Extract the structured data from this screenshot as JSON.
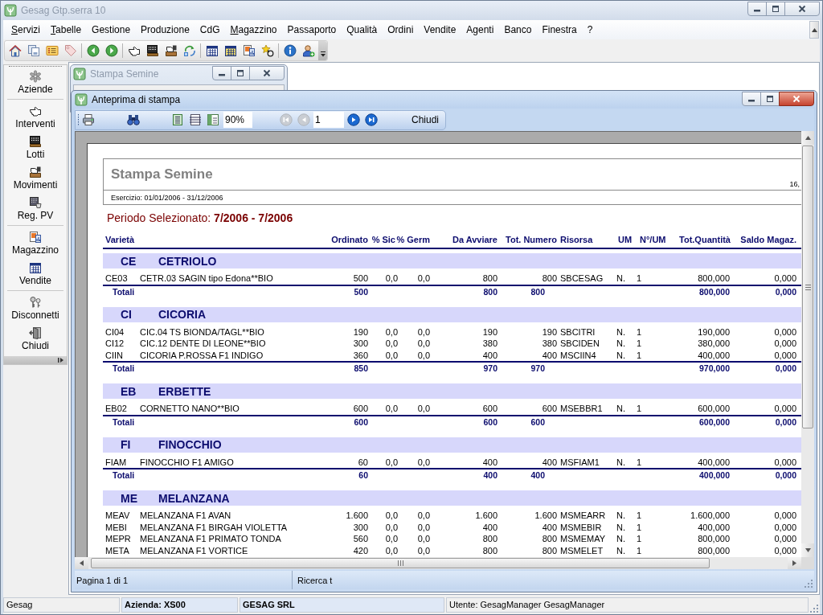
{
  "window": {
    "title": "Gesag Gtp.serra 10",
    "active": false
  },
  "menu": [
    {
      "label": "Servizi",
      "underlined": true
    },
    {
      "label": "Tabelle",
      "underlined": true
    },
    {
      "label": "Gestione",
      "underlined": false
    },
    {
      "label": "Produzione",
      "underlined": false
    },
    {
      "label": "CdG",
      "underlined": false
    },
    {
      "label": "Magazzino",
      "underlined": true
    },
    {
      "label": "Passaporto",
      "underlined": false
    },
    {
      "label": "Qualità",
      "underlined": false
    },
    {
      "label": "Ordini",
      "underlined": false
    },
    {
      "label": "Vendite",
      "underlined": false
    },
    {
      "label": "Agenti",
      "underlined": false
    },
    {
      "label": "Banco",
      "underlined": false
    },
    {
      "label": "Finestra",
      "underlined": false
    },
    {
      "label": "?",
      "underlined": false
    }
  ],
  "sidebar": {
    "groups": [
      [
        {
          "label": "Aziende"
        }
      ],
      [
        {
          "label": "Interventi"
        },
        {
          "label": "Lotti"
        },
        {
          "label": "Movimenti"
        },
        {
          "label": "Reg. PV"
        }
      ],
      [
        {
          "label": "Magazzino"
        },
        {
          "label": "Vendite"
        }
      ],
      [
        {
          "label": "Disconnetti"
        },
        {
          "label": "Chiudi"
        }
      ]
    ]
  },
  "background_window": {
    "title": "Stampa Semine",
    "active": false
  },
  "preview_window": {
    "title": "Anteprima di stampa",
    "active": true,
    "toolbar": {
      "zoom": "90%",
      "page": "1",
      "close_label": "Chiudi",
      "nav": [
        {
          "kind": "first",
          "disabled": true
        },
        {
          "kind": "previous",
          "disabled": true
        },
        {
          "kind": "next",
          "disabled": false
        },
        {
          "kind": "last",
          "disabled": false
        }
      ]
    },
    "report": {
      "title": "Stampa Semine",
      "corner_text": "16,",
      "period": "Esercizio: 01/01/2006 - 31/12/2006",
      "selection": "Periodo Selezionato: **7/2006 - 7/2006**",
      "columns": [
        "Varietà",
        "Ordinato",
        "% Sic",
        "% Germ",
        "Da Avviare",
        "Tot. Numero",
        "Risorsa",
        "UM",
        "N°/UM",
        "Tot.Quantità",
        "Saldo Magaz."
      ],
      "groups": [
        {
          "code": "CE",
          "name": "CETRIOLO",
          "rows": [
            [
              "CE03",
              "CETR.03 SAGIN tipo Edona**BIO",
              "500",
              "0,0",
              "0,0",
              "800",
              "800",
              "SBCESAG",
              "N.",
              "1",
              "800,000",
              "0,000"
            ]
          ],
          "totals": {
            "label": "Totali",
            "ordinato": "500",
            "da_avviare": "800",
            "tot_numero": "800",
            "tot_quantita": "800,000",
            "saldo": "0,000"
          }
        },
        {
          "code": "CI",
          "name": "CICORIA",
          "rows": [
            [
              "CI04",
              "CIC.04 TS BIONDA/TAGL**BIO",
              "190",
              "0,0",
              "0,0",
              "190",
              "190",
              "SBCITRI",
              "N.",
              "1",
              "190,000",
              "0,000"
            ],
            [
              "CI12",
              "CIC.12 DENTE DI LEONE**BIO",
              "300",
              "0,0",
              "0,0",
              "380",
              "380",
              "SBCIDEN",
              "N.",
              "1",
              "380,000",
              "0,000"
            ],
            [
              "CIIN",
              "CICORIA P.ROSSA F1 INDIGO",
              "360",
              "0,0",
              "0,0",
              "400",
              "400",
              "MSCIIN4",
              "N.",
              "1",
              "400,000",
              "0,000"
            ]
          ],
          "totals": {
            "label": "Totali",
            "ordinato": "850",
            "da_avviare": "970",
            "tot_numero": "970",
            "tot_quantita": "970,000",
            "saldo": "0,000"
          }
        },
        {
          "code": "EB",
          "name": "ERBETTE",
          "rows": [
            [
              "EB02",
              "CORNETTO NANO**BIO",
              "600",
              "0,0",
              "0,0",
              "600",
              "600",
              "MSEBBR1",
              "N.",
              "1",
              "600,000",
              "0,000"
            ]
          ],
          "totals": {
            "label": "Totali",
            "ordinato": "600",
            "da_avviare": "600",
            "tot_numero": "600",
            "tot_quantita": "600,000",
            "saldo": "0,000"
          }
        },
        {
          "code": "FI",
          "name": "FINOCCHIO",
          "rows": [
            [
              "FIAM",
              "FINOCCHIO F1 AMIGO",
              "60",
              "0,0",
              "0,0",
              "400",
              "400",
              "MSFIAM1",
              "N.",
              "1",
              "400,000",
              "0,000"
            ]
          ],
          "totals": {
            "label": "Totali",
            "ordinato": "60",
            "da_avviare": "400",
            "tot_numero": "400",
            "tot_quantita": "400,000",
            "saldo": "0,000"
          }
        },
        {
          "code": "ME",
          "name": "MELANZANA",
          "rows": [
            [
              "MEAV",
              "MELANZANA F1 AVAN",
              "1.600",
              "0,0",
              "0,0",
              "1.600",
              "1.600",
              "MSMEARR",
              "N.",
              "1",
              "1.600,000",
              "0,000"
            ],
            [
              "MEBI",
              "MELANZANA F1 BIRGAH VIOLETTA",
              "300",
              "0,0",
              "0,0",
              "400",
              "400",
              "MSMEBIR",
              "N.",
              "1",
              "400,000",
              "0,000"
            ],
            [
              "MEPR",
              "MELANZANA F1 PRIMATO TONDA",
              "560",
              "0,0",
              "0,0",
              "800",
              "800",
              "MSMEMAY",
              "N.",
              "1",
              "800,000",
              "0,000"
            ],
            [
              "META",
              "MELANZANA F1 VORTICE",
              "420",
              "0,0",
              "0,0",
              "800",
              "800",
              "MSMELET",
              "N.",
              "1",
              "800,000",
              "0,000"
            ]
          ]
        }
      ]
    },
    "status_bar": [
      "Pagina 1 di 1",
      "Ricerca t"
    ]
  },
  "status_bar": [
    {
      "text": "Gesag",
      "highlighted": false
    },
    {
      "text": "Azienda: XS00",
      "highlighted": true
    },
    {
      "text": "GESAG SRL",
      "highlighted": true
    },
    {
      "text": "Utente: GesagManager GesagManager",
      "highlighted": false
    }
  ]
}
